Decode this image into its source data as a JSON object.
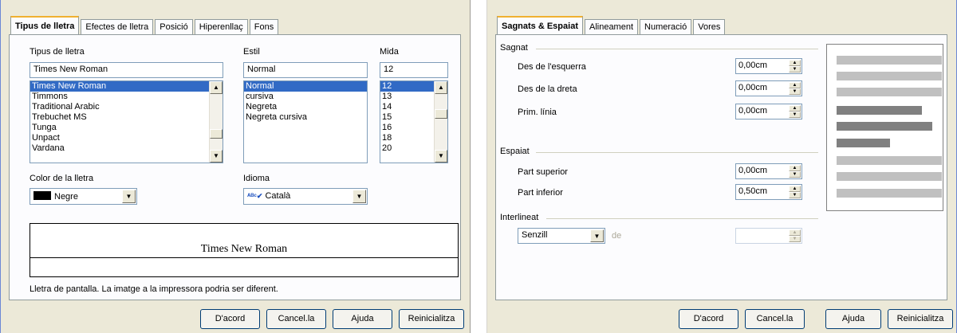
{
  "left": {
    "tabs": [
      {
        "label": "Tipus de lletra",
        "active": true
      },
      {
        "label": "Efectes de lletra",
        "active": false
      },
      {
        "label": "Posició",
        "active": false
      },
      {
        "label": "Hiperenllaç",
        "active": false
      },
      {
        "label": "Fons",
        "active": false
      }
    ],
    "font_label": "Tipus de lletra",
    "font_value": "Times New Roman",
    "font_list": [
      "Times New Roman",
      "Timmons",
      "Traditional Arabic",
      "Trebuchet MS",
      "Tunga",
      "Unpact",
      "Vardana"
    ],
    "style_label": "Estil",
    "style_value": "Normal",
    "style_list": [
      "Normal",
      "cursiva",
      "Negreta",
      "Negreta cursiva"
    ],
    "size_label": "Mida",
    "size_value": "12",
    "size_list": [
      "12",
      "13",
      "14",
      "15",
      "16",
      "18",
      "20"
    ],
    "color_label": "Color de la lletra",
    "color_value": "Negre",
    "lang_label": "Idioma",
    "lang_value": "Català",
    "preview_text": "Times New Roman",
    "note": "Lletra de pantalla. La imatge a la impressora podria ser diferent.",
    "buttons": {
      "ok": "D'acord",
      "cancel": "Cancel.la",
      "help": "Ajuda",
      "reset": "Reinicialitza"
    }
  },
  "right": {
    "tabs": [
      {
        "label": "Sagnats & Espaiat",
        "active": true
      },
      {
        "label": "Alineament",
        "active": false
      },
      {
        "label": "Numeració",
        "active": false
      },
      {
        "label": "Vores",
        "active": false
      }
    ],
    "indent_group": "Sagnat",
    "indent_left_label": "Des de l'esquerra",
    "indent_left_value": "0,00cm",
    "indent_right_label": "Des de la dreta",
    "indent_right_value": "0,00cm",
    "first_line_label": "Prim. línia",
    "first_line_value": "0,00cm",
    "spacing_group": "Espaiat",
    "above_label": "Part superior",
    "above_value": "0,00cm",
    "below_label": "Part inferior",
    "below_value": "0,50cm",
    "line_group": "Interlineat",
    "line_value": "Senzill",
    "line_de": "de",
    "buttons": {
      "ok": "D'acord",
      "cancel": "Cancel.la",
      "help": "Ajuda",
      "reset": "Reinicialitza"
    }
  },
  "colors": {
    "selection": "#316ac5",
    "dialog_bg": "#ece9d8",
    "tab_highlight": "#f0b030"
  }
}
